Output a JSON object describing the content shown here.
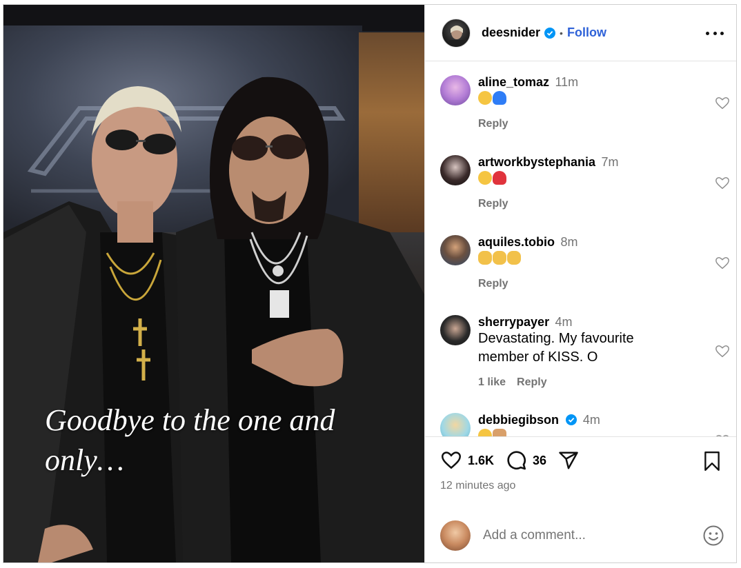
{
  "post": {
    "caption_line1": "Goodbye to the one and",
    "caption_line2": "only…"
  },
  "header": {
    "username": "deesnider",
    "separator": "•",
    "follow_label": "Follow",
    "more_icon": "more-horizontal-icon"
  },
  "comments": [
    {
      "user": "aline_tomaz",
      "time": "11m",
      "emojis": [
        "crying-face",
        "blue-heart"
      ],
      "reply": "Reply",
      "avatar_color": "#b47ed6"
    },
    {
      "user": "artworkbystephania",
      "time": "7m",
      "emojis": [
        "crying-face",
        "broken-heart"
      ],
      "reply": "Reply",
      "avatar_color": "#2a2222"
    },
    {
      "user": "aquiles.tobio",
      "time": "8m",
      "emojis": [
        "clapping-hands",
        "clapping-hands",
        "clapping-hands"
      ],
      "reply": "Reply",
      "avatar_color": "#4a6b8a"
    },
    {
      "user": "sherrypayer",
      "time": "4m",
      "text_line1": "Devastating. My favourite",
      "text_line2": "member of KISS. O",
      "likes": "1 like",
      "reply": "Reply",
      "avatar_color": "#3a3a3a"
    },
    {
      "user": "debbiegibson",
      "time": "4m",
      "emojis": [
        "crying-face",
        "rock-hand"
      ],
      "avatar_color": "#7fc7d9"
    }
  ],
  "actions": {
    "like_count": "1.6K",
    "comment_count": "36",
    "timestamp": "12 minutes ago"
  },
  "add_comment": {
    "placeholder": "Add a comment..."
  },
  "colors": {
    "follow_blue": "#2f62d8",
    "verified_blue": "#0095f6",
    "muted_gray": "#737373"
  }
}
